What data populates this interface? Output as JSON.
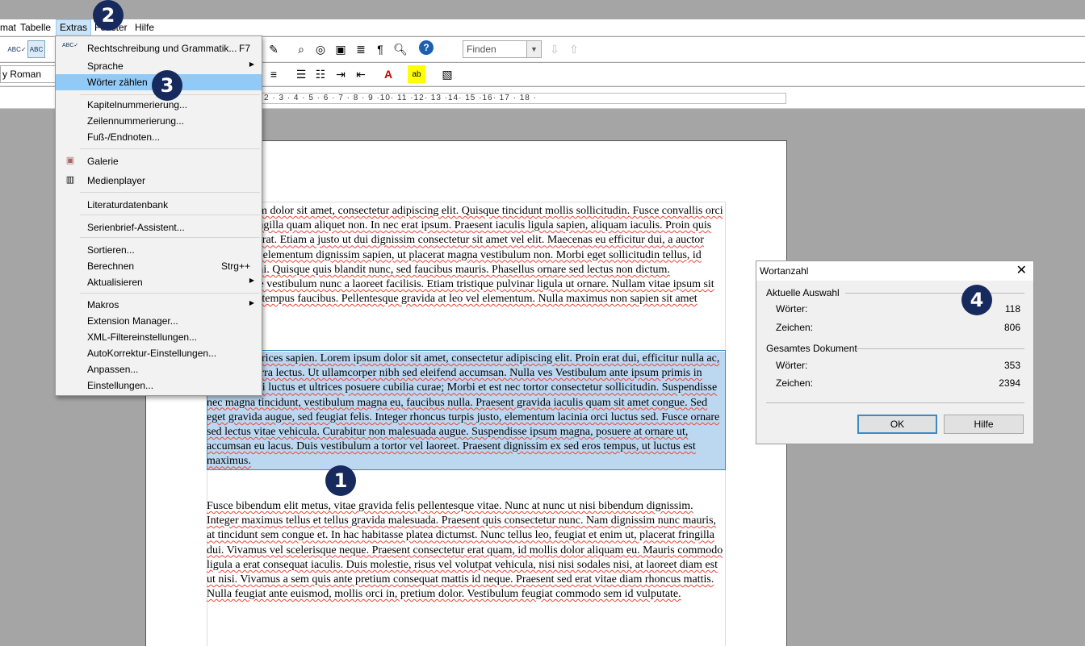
{
  "menubar": {
    "items": [
      "mat",
      "Tabelle",
      "Extras",
      "Fenster",
      "Hilfe"
    ]
  },
  "toolbar": {
    "font_name": "y Roman",
    "find_placeholder": "Finden"
  },
  "ruler": {
    "scale_text": "2 · 3 · 4 · 5 · 6 · 7 · 8 · 9 ·10· 11 ·12· 13 ·14· 15 ·16· 17 · 18 ·"
  },
  "document": {
    "para1": "Lorem ipsum dolor sit amet, consectetur adipiscing elit. Quisque tincidunt mollis sollicitudin. Fusce convallis orci lacus, in fringilla quam aliquet non. In nec erat ipsum. Praesent iaculis ligula sapien, aliquam iaculis. Proin quis malesuada erat. Etiam a justo ut dui dignissim consectetur sit amet vel elit. Maecenas eu efficitur dui, a auctor risus. Fusce elementum dignissim sapien, ut placerat magna vestibulum non. Morbi eget sollicitudin tellus, id consequat mi. Quisque quis blandit nunc, sed faucibus mauris. Phasellus ornare sed lectus non dictum. Pellentesque vestibulum nunc a laoreet facilisis. Etiam tristique pulvinar ligula ut ornare. Nullam vitae ipsum sit amet massa tempus faucibus. Pellentesque gravida at leo vel elementum. Nulla maximus non sapien sit amet",
    "para2": "Vivamus ultrices sapien. Lorem ipsum dolor sit amet, consectetur adipiscing elit. Proin erat dui, efficitur nulla ac, feugiat viverra lectus. Ut ullamcorper nibh sed eleifend accumsan. Nulla ves Vestibulum ante ipsum primis in faucibus orci luctus et ultrices posuere cubilia curae; Morbi et est nec tortor consectetur sollicitudin. Suspendisse nec magna tincidunt, vestibulum magna eu, faucibus nulla. Praesent gravida iaculis quam sit amet congue. Sed eget gravida augue, sed feugiat felis. Integer rhoncus turpis justo, elementum lacinia orci luctus sed. Fusce ornare sed lectus vitae vehicula. Curabitur non malesuada augue. Suspendisse ipsum magna, posuere at ornare ut, accumsan eu lacus. Duis vestibulum a tortor vel laoreet. Praesent dignissim ex sed eros tempus, ut luctus est maximus.",
    "para3": "Fusce bibendum elit metus, vitae gravida felis pellentesque vitae. Nunc at nunc ut nisi bibendum dignissim. Integer maximus tellus et tellus gravida malesuada. Praesent quis consectetur nunc. Nam dignissim nunc mauris, at tincidunt sem congue et. In hac habitasse platea dictumst. Nunc tellus leo, feugiat et enim ut, placerat fringilla dui. Vivamus vel scelerisque neque. Praesent consectetur erat quam, id mollis dolor aliquam eu. Mauris commodo ligula a erat consequat iaculis. Duis molestie, risus vel volutpat vehicula, nisi nisi sodales nisi, at laoreet diam est ut nisi. Vivamus a sem quis ante pretium consequat mattis id neque. Praesent sed erat vitae diam rhoncus mattis. Nulla feugiat ante euismod, mollis orci in, pretium dolor. Vestibulum feugiat commodo sem id vulputate."
  },
  "extras_menu": {
    "items": [
      {
        "label": "Rechtschreibung und Grammatik...",
        "shortcut": "F7"
      },
      {
        "label": "Sprache"
      },
      {
        "label": "Wörter zählen"
      },
      {
        "label": "Kapitelnummerierung..."
      },
      {
        "label": "Zeilennummerierung..."
      },
      {
        "label": "Fuß-/Endnoten..."
      },
      {
        "label": "Galerie"
      },
      {
        "label": "Medienplayer"
      },
      {
        "label": "Literaturdatenbank"
      },
      {
        "label": "Serienbrief-Assistent..."
      },
      {
        "label": "Sortieren..."
      },
      {
        "label": "Berechnen",
        "shortcut": "Strg++"
      },
      {
        "label": "Aktualisieren"
      },
      {
        "label": "Makros"
      },
      {
        "label": "Extension Manager..."
      },
      {
        "label": "XML-Filtereinstellungen..."
      },
      {
        "label": "AutoKorrektur-Einstellungen..."
      },
      {
        "label": "Anpassen..."
      },
      {
        "label": "Einstellungen..."
      }
    ]
  },
  "word_count_dialog": {
    "title": "Wortanzahl",
    "selection_group": "Aktuelle Auswahl",
    "selection_words_label": "Wörter:",
    "selection_words": "118",
    "selection_chars_label": "Zeichen:",
    "selection_chars": "806",
    "document_group": "Gesamtes Dokument",
    "document_words_label": "Wörter:",
    "document_words": "353",
    "document_chars_label": "Zeichen:",
    "document_chars": "2394",
    "ok_label": "OK",
    "help_label": "Hilfe"
  },
  "callouts": [
    "1",
    "2",
    "3",
    "4"
  ],
  "colors": {
    "selection": "#bcd7f0",
    "menu_highlight": "#91c9f7",
    "callout": "#162a5e"
  }
}
